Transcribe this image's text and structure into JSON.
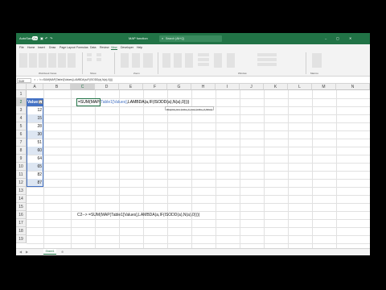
{
  "titlebar": {
    "autosave_label": "AutoSave",
    "autosave_state": "On",
    "filename": "MAP function",
    "search_placeholder": "Search (Alt+Q)"
  },
  "ribbon_tabs": [
    "File",
    "Home",
    "Insert",
    "Draw",
    "Page Layout",
    "Formulas",
    "Data",
    "Review",
    "View",
    "Developer",
    "Help"
  ],
  "ribbon_active_tab": "View",
  "ribbon_groups": [
    "Workbook Views",
    "Show",
    "Zoom",
    "Window",
    "Macros"
  ],
  "formula_bar": {
    "name_box": "SUM",
    "formula": "=SUM(MAP(Table1[Values],LAMBDA(a,IF(ISODD(a),N(a),0))))"
  },
  "columns": [
    "A",
    "B",
    "C",
    "D",
    "E",
    "F",
    "G",
    "H",
    "I",
    "J",
    "K",
    "L",
    "M",
    "N"
  ],
  "rows": [
    "1",
    "2",
    "3",
    "4",
    "5",
    "6",
    "7",
    "8",
    "9",
    "10",
    "11",
    "12",
    "13",
    "14",
    "15",
    "16",
    "17",
    "18",
    "19"
  ],
  "table": {
    "header": "Values",
    "filter_icon": "▾",
    "values": [
      12,
      15,
      28,
      30,
      51,
      60,
      64,
      65,
      82,
      87
    ]
  },
  "active_cell": {
    "prefix": "=SUM(MAP(",
    "ref": "Table1[Values]",
    "suffix": ",LAMBDA(a,IF(ISODD(a),N(a),0))))"
  },
  "tooltip": "If(logical_test, [value_if_true], [value_if_false])",
  "note_text": "C2--> =SUM(MAP(Table1[Values],LAMBDA(a,IF(ISODD(a),N(a),0))))",
  "sheet_tab": "Sheet1",
  "colors": {
    "excel_green": "#217346",
    "table_blue": "#4472c4",
    "band_blue": "#dde6f2"
  }
}
